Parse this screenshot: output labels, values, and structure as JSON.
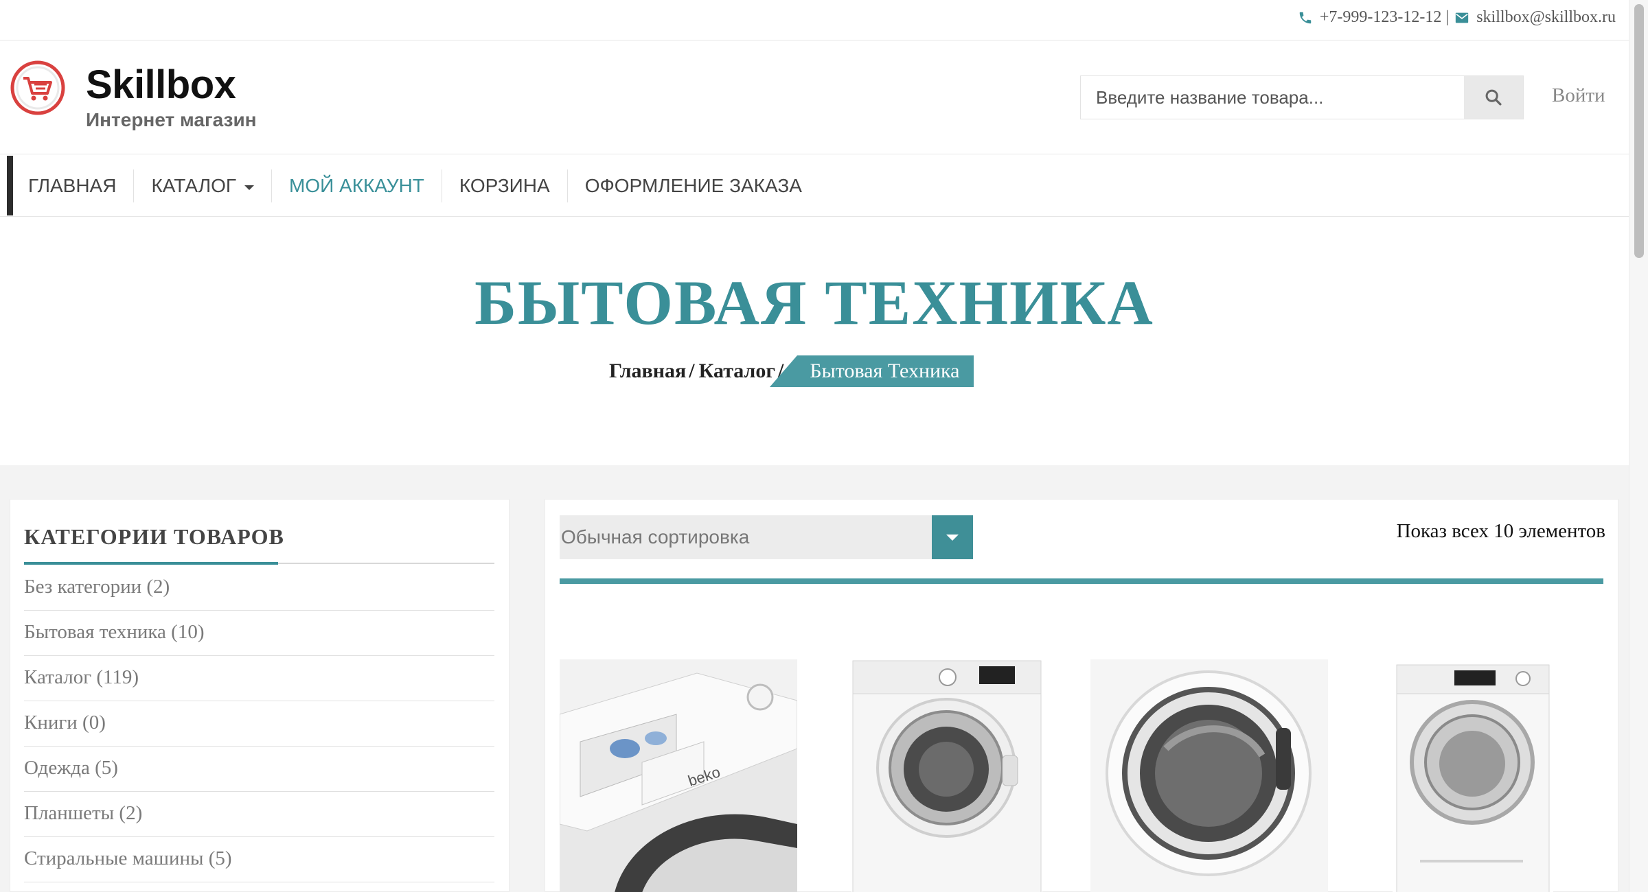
{
  "topbar": {
    "phone": "+7-999-123-12-12",
    "separator": "|",
    "email": "skillbox@skillbox.ru",
    "icons": [
      "phone-icon",
      "envelope-icon"
    ]
  },
  "header": {
    "logo_title": "Skillbox",
    "logo_subtitle": "Интернет магазин",
    "search_placeholder": "Введите название товара...",
    "login_label": "Войти"
  },
  "nav": {
    "items": [
      {
        "label": "ГЛАВНАЯ"
      },
      {
        "label": "КАТАЛОГ",
        "has_dropdown": true
      },
      {
        "label": "МОЙ АККАУНТ",
        "active": true
      },
      {
        "label": "КОРЗИНА"
      },
      {
        "label": "ОФОРМЛЕНИЕ ЗАКАЗА"
      }
    ]
  },
  "page": {
    "title": "БЫТОВАЯ ТЕХНИКА",
    "breadcrumbs": [
      "Главная",
      "Каталог",
      "Бытовая Техника"
    ]
  },
  "sidebar": {
    "heading": "КАТЕГОРИИ ТОВАРОВ",
    "categories": [
      {
        "label": "Без категории (2)"
      },
      {
        "label": "Бытовая техника (10)"
      },
      {
        "label": "Каталог (119)"
      },
      {
        "label": "Книги (0)"
      },
      {
        "label": "Одежда (5)"
      },
      {
        "label": "Планшеты (2)"
      },
      {
        "label": "Стиральные машины (5)"
      }
    ]
  },
  "shop": {
    "sort_selected": "Обычная сортировка",
    "result_count": "Показ всех 10 элементов",
    "products": [
      {
        "image": "washing-machine-beko-detail"
      },
      {
        "image": "washing-machine-beko-front"
      },
      {
        "image": "washing-machine-door-closeup"
      },
      {
        "image": "washing-machine-candy-front"
      }
    ]
  },
  "colors": {
    "accent": "#3a8f98",
    "logo_red": "#d9413f",
    "text_dark": "#222222"
  }
}
